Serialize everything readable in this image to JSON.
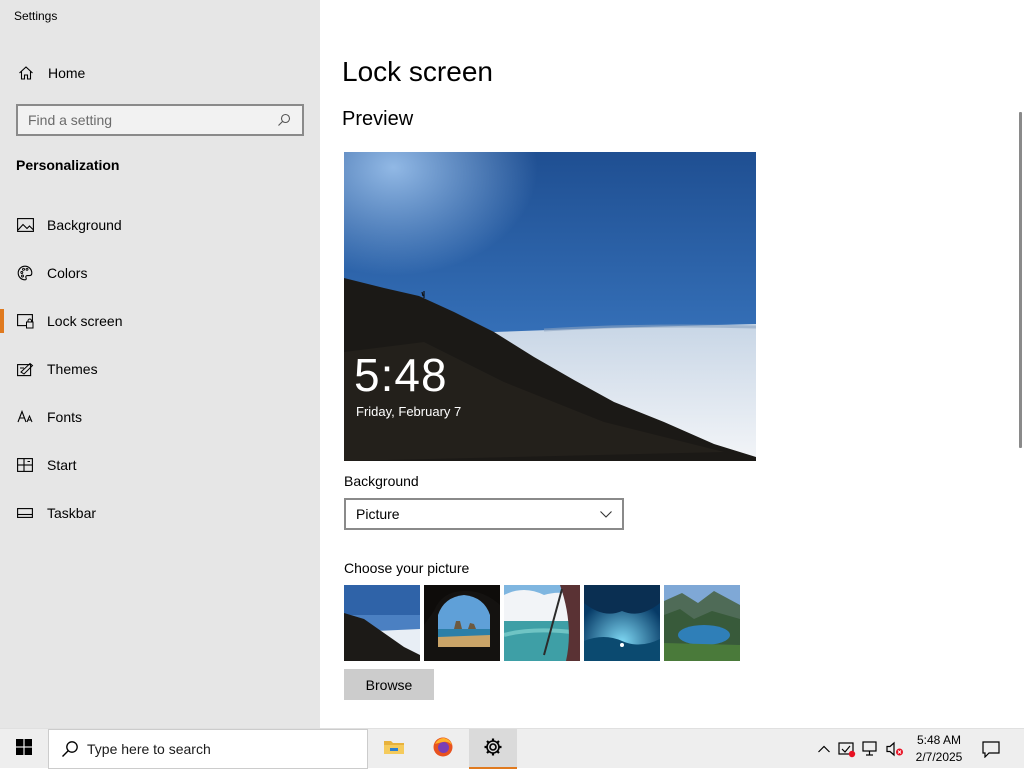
{
  "window": {
    "title": "Settings"
  },
  "sidebar": {
    "home_label": "Home",
    "search_placeholder": "Find a setting",
    "section_title": "Personalization",
    "items": [
      {
        "label": "Background",
        "icon": "picture-icon",
        "active": false
      },
      {
        "label": "Colors",
        "icon": "palette-icon",
        "active": false
      },
      {
        "label": "Lock screen",
        "icon": "lock-screen-icon",
        "active": true
      },
      {
        "label": "Themes",
        "icon": "themes-icon",
        "active": false
      },
      {
        "label": "Fonts",
        "icon": "fonts-icon",
        "active": false
      },
      {
        "label": "Start",
        "icon": "start-icon",
        "active": false
      },
      {
        "label": "Taskbar",
        "icon": "taskbar-icon",
        "active": false
      }
    ]
  },
  "main": {
    "page_title": "Lock screen",
    "preview_title": "Preview",
    "preview_time": "5:48",
    "preview_date": "Friday, February 7",
    "background_label": "Background",
    "background_value": "Picture",
    "choose_label": "Choose your picture",
    "thumbnails": [
      "mountain-slope-clouds",
      "cave-beach-rocks",
      "airplane-window-ocean",
      "underwater-cave-blue",
      "mountain-lake-valley"
    ],
    "browse_label": "Browse"
  },
  "taskbar": {
    "search_placeholder": "Type here to search",
    "apps": [
      "file-explorer",
      "firefox",
      "settings"
    ],
    "clock_time": "5:48 AM",
    "clock_date": "2/7/2025"
  },
  "colors": {
    "accent": "#e07a1f",
    "sidebar_bg": "#e6e6e6",
    "taskbar_bg": "#eeeeee"
  }
}
